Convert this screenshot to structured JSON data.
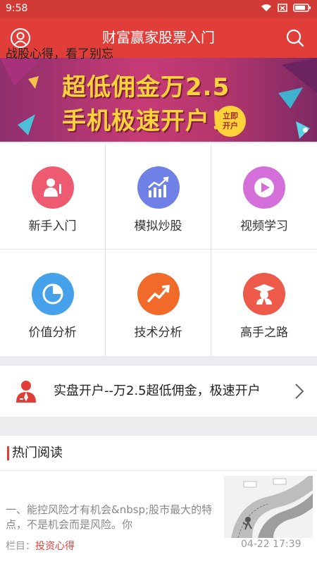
{
  "status": {
    "time": "9:58"
  },
  "header": {
    "title": "财富赢家股票入门"
  },
  "banner": {
    "line1": "超低佣金万2.5",
    "line2": "手机极速开户！",
    "cta": [
      "立即",
      "开户"
    ]
  },
  "grid": {
    "items": [
      {
        "label": "新手入门",
        "icon": "beginner-icon",
        "color": "#ee5a6f"
      },
      {
        "label": "模拟炒股",
        "icon": "trend-chart-icon",
        "color": "#6f80e6"
      },
      {
        "label": "视频学习",
        "icon": "play-icon",
        "color": "#d46fd9"
      },
      {
        "label": "价值分析",
        "icon": "pie-chart-icon",
        "color": "#45a2ea"
      },
      {
        "label": "技术分析",
        "icon": "rising-arrow-icon",
        "color": "#f26a2a"
      },
      {
        "label": "高手之路",
        "icon": "graduate-icon",
        "color": "#ee5a4a"
      }
    ]
  },
  "promo": {
    "text": "实盘开户--万2.5超低佣金，极速开户"
  },
  "hot": {
    "title": "热门阅读",
    "article": {
      "title": "战股心得，看了别忘",
      "summary": "一、能控风险才有机会&nbsp;股市最大的特点，不是机会而是风险。你",
      "category_label": "栏目：",
      "category": "投资心得",
      "date": "04-22 17:39"
    }
  }
}
